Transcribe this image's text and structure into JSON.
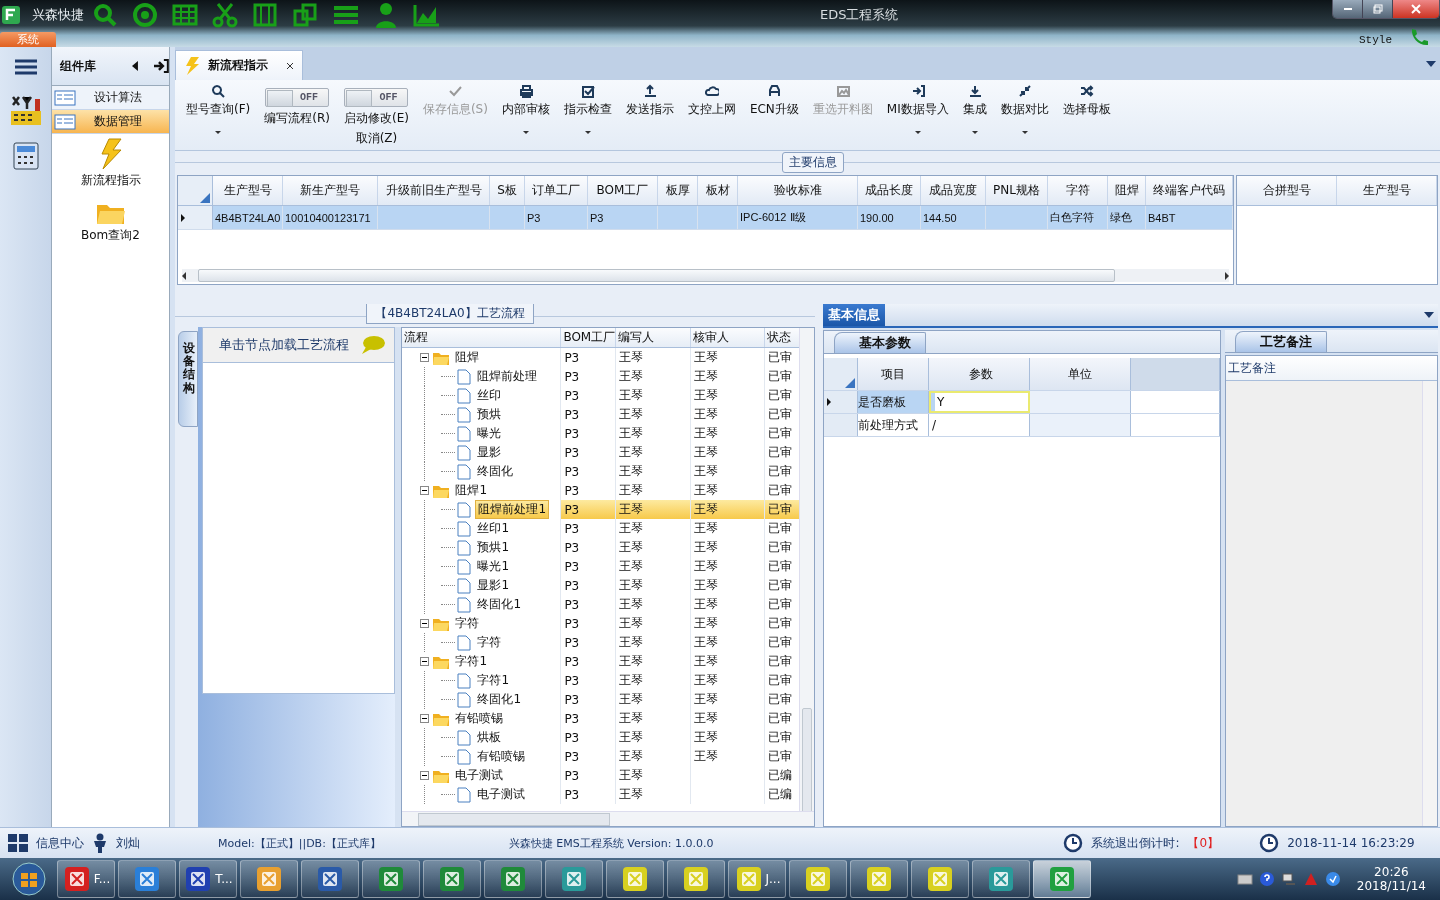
{
  "title_bar": {
    "app_name": "兴森快捷",
    "title": "EDS工程系统",
    "menu_tab": "系统",
    "style_label": "Style"
  },
  "component_panel": {
    "title": "组件库",
    "items": [
      {
        "label": "设计算法",
        "selected": false
      },
      {
        "label": "数据管理",
        "selected": true
      }
    ],
    "tools": [
      {
        "label": "新流程指示"
      },
      {
        "label": "Bom查询2"
      }
    ]
  },
  "document_tab": {
    "label": "新流程指示"
  },
  "ribbon": [
    {
      "kind": "button",
      "label": "型号查询(F)",
      "dropdown": true,
      "disabled": false
    },
    {
      "kind": "toggle",
      "state_text": "OFF",
      "on": false,
      "label": "编写流程(R)"
    },
    {
      "kind": "toggle",
      "state_text": "OFF",
      "on": false,
      "label": "启动修改(E)",
      "label_2": "取消(Z)"
    },
    {
      "kind": "button",
      "label": "保存信息(S)",
      "dropdown": false,
      "disabled": true
    },
    {
      "kind": "button",
      "label": "内部审核",
      "dropdown": true,
      "disabled": false
    },
    {
      "kind": "button",
      "label": "指示检查",
      "dropdown": true,
      "disabled": false
    },
    {
      "kind": "button",
      "label": "发送指示",
      "dropdown": false,
      "disabled": false
    },
    {
      "kind": "button",
      "label": "文控上网",
      "dropdown": false,
      "disabled": false
    },
    {
      "kind": "button",
      "label": "ECN升级",
      "dropdown": false,
      "disabled": false
    },
    {
      "kind": "button",
      "label": "重选开料图",
      "dropdown": false,
      "disabled": true
    },
    {
      "kind": "button",
      "label": "MI数据导入",
      "dropdown": true,
      "disabled": false
    },
    {
      "kind": "button",
      "label": "集成",
      "dropdown": true,
      "disabled": false
    },
    {
      "kind": "button",
      "label": "数据对比",
      "dropdown": true,
      "disabled": false
    },
    {
      "kind": "button",
      "label": "选择母板",
      "dropdown": false,
      "disabled": false
    }
  ],
  "main_info": {
    "title": "主要信息",
    "columns": [
      "生产型号",
      "新生产型号",
      "升级前旧生产型号",
      "S板",
      "订单工厂",
      "BOM工厂",
      "板厚",
      "板材",
      "验收标准",
      "成品长度",
      "成品宽度",
      "PNL规格",
      "字符",
      "阻焊",
      "终端客户代码"
    ],
    "rows": [
      {
        "selected": true,
        "cells": [
          "4B4BT24LA0",
          "10010400123171",
          "",
          "",
          "P3",
          "P3",
          "",
          "",
          "IPC-6012 Ⅱ级",
          "190.00",
          "144.50",
          "",
          "白色字符",
          "绿色",
          "B4BT"
        ]
      }
    ],
    "side_columns": [
      "合拼型号",
      "生产型号"
    ]
  },
  "process": {
    "title": "【4B4BT24LA0】工艺流程",
    "side_tab": "设备结构",
    "hint": "单击节点加载工艺流程",
    "columns": [
      "流程",
      "BOM工厂",
      "编写人",
      "核审人",
      "状态"
    ],
    "nodes": [
      {
        "name": "阻焊",
        "bom": "P3",
        "author": "王琴",
        "reviewer": "王琴",
        "status": "已审",
        "expanded": true,
        "selected": false,
        "children": [
          {
            "name": "阻焊前处理",
            "bom": "P3",
            "author": "王琴",
            "reviewer": "王琴",
            "status": "已审",
            "selected": false
          },
          {
            "name": "丝印",
            "bom": "P3",
            "author": "王琴",
            "reviewer": "王琴",
            "status": "已审",
            "selected": false
          },
          {
            "name": "预烘",
            "bom": "P3",
            "author": "王琴",
            "reviewer": "王琴",
            "status": "已审",
            "selected": false
          },
          {
            "name": "曝光",
            "bom": "P3",
            "author": "王琴",
            "reviewer": "王琴",
            "status": "已审",
            "selected": false
          },
          {
            "name": "显影",
            "bom": "P3",
            "author": "王琴",
            "reviewer": "王琴",
            "status": "已审",
            "selected": false
          },
          {
            "name": "终固化",
            "bom": "P3",
            "author": "王琴",
            "reviewer": "王琴",
            "status": "已审",
            "selected": false
          }
        ]
      },
      {
        "name": "阻焊1",
        "bom": "P3",
        "author": "王琴",
        "reviewer": "王琴",
        "status": "已审",
        "expanded": true,
        "selected": false,
        "children": [
          {
            "name": "阻焊前处理1",
            "bom": "P3",
            "author": "王琴",
            "reviewer": "王琴",
            "status": "已审",
            "selected": true
          },
          {
            "name": "丝印1",
            "bom": "P3",
            "author": "王琴",
            "reviewer": "王琴",
            "status": "已审",
            "selected": false
          },
          {
            "name": "预烘1",
            "bom": "P3",
            "author": "王琴",
            "reviewer": "王琴",
            "status": "已审",
            "selected": false
          },
          {
            "name": "曝光1",
            "bom": "P3",
            "author": "王琴",
            "reviewer": "王琴",
            "status": "已审",
            "selected": false
          },
          {
            "name": "显影1",
            "bom": "P3",
            "author": "王琴",
            "reviewer": "王琴",
            "status": "已审",
            "selected": false
          },
          {
            "name": "终固化1",
            "bom": "P3",
            "author": "王琴",
            "reviewer": "王琴",
            "status": "已审",
            "selected": false
          }
        ]
      },
      {
        "name": "字符",
        "bom": "P3",
        "author": "王琴",
        "reviewer": "王琴",
        "status": "已审",
        "expanded": true,
        "selected": false,
        "children": [
          {
            "name": "字符",
            "bom": "P3",
            "author": "王琴",
            "reviewer": "王琴",
            "status": "已审",
            "selected": false
          }
        ]
      },
      {
        "name": "字符1",
        "bom": "P3",
        "author": "王琴",
        "reviewer": "王琴",
        "status": "已审",
        "expanded": true,
        "selected": false,
        "children": [
          {
            "name": "字符1",
            "bom": "P3",
            "author": "王琴",
            "reviewer": "王琴",
            "status": "已审",
            "selected": false
          },
          {
            "name": "终固化1",
            "bom": "P3",
            "author": "王琴",
            "reviewer": "王琴",
            "status": "已审",
            "selected": false
          }
        ]
      },
      {
        "name": "有铅喷锡",
        "bom": "P3",
        "author": "王琴",
        "reviewer": "王琴",
        "status": "已审",
        "expanded": true,
        "selected": false,
        "children": [
          {
            "name": "烘板",
            "bom": "P3",
            "author": "王琴",
            "reviewer": "王琴",
            "status": "已审",
            "selected": false
          },
          {
            "name": "有铅喷锡",
            "bom": "P3",
            "author": "王琴",
            "reviewer": "王琴",
            "status": "已审",
            "selected": false
          }
        ]
      },
      {
        "name": "电子测试",
        "bom": "P3",
        "author": "王琴",
        "status": "已编",
        "expanded": true,
        "selected": false,
        "children": [
          {
            "name": "电子测试",
            "bom": "P3",
            "author": "王琴",
            "status": "已编",
            "selected": false
          }
        ]
      }
    ]
  },
  "basic_info": {
    "tab": "基本信息",
    "sub_tab": "基本参数",
    "columns": [
      "项目",
      "参数",
      "单位"
    ],
    "rows": [
      {
        "item": "是否磨板",
        "value": "Y",
        "unit": "",
        "selected": true
      },
      {
        "item": "前处理方式",
        "value": "/",
        "unit": "",
        "selected": false
      }
    ],
    "notes_tab": "工艺备注",
    "notes_column": "工艺备注"
  },
  "status_bar": {
    "info_center": "信息中心",
    "user": "刘灿",
    "model": "Model:【正式】||DB:【正式库】",
    "version": "兴森快捷 EMS工程系统 Version: 1.0.0.0",
    "countdown_label": "系统退出倒计时:",
    "countdown": "【0】",
    "datetime": "2018-11-14 16:23:29"
  },
  "taskbar": {
    "buttons": [
      {
        "label": "F...",
        "selected": false
      },
      {
        "selected": false
      },
      {
        "label": "T...",
        "selected": false
      },
      {
        "selected": false
      },
      {
        "selected": false
      },
      {
        "selected": false
      },
      {
        "selected": false
      },
      {
        "selected": false
      },
      {
        "selected": false
      },
      {
        "selected": false
      },
      {
        "selected": false
      },
      {
        "label": "J...",
        "selected": false
      },
      {
        "selected": false
      },
      {
        "selected": false
      },
      {
        "selected": false
      },
      {
        "selected": false
      },
      {
        "selected": true
      }
    ],
    "time": "20:26",
    "date": "2018/11/14"
  }
}
